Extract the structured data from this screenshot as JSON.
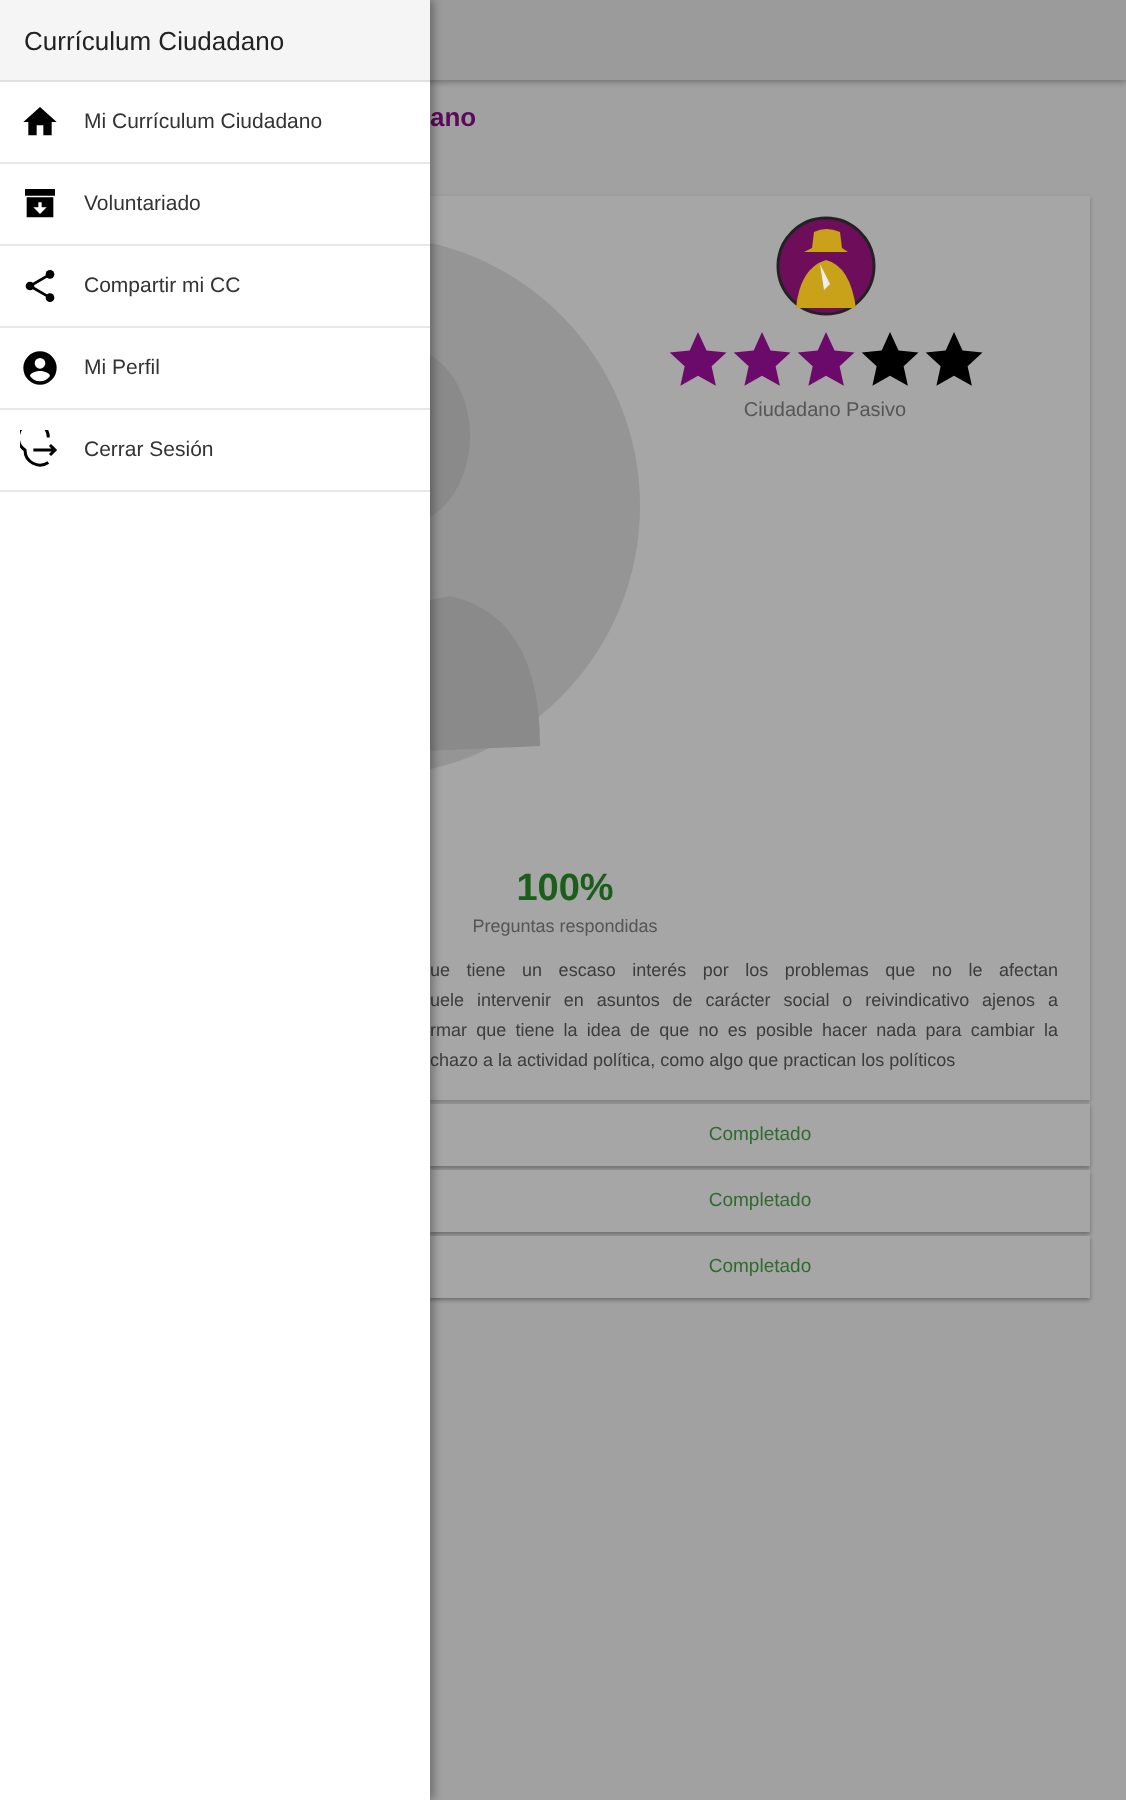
{
  "drawer": {
    "title": "Currículum Ciudadano",
    "items": [
      {
        "label": "Mi Currículum Ciudadano",
        "kind": "home"
      },
      {
        "label": "Voluntariado",
        "kind": "archive"
      },
      {
        "label": "Compartir mi CC",
        "kind": "share"
      },
      {
        "label": "Mi Perfil",
        "kind": "account"
      },
      {
        "label": "Cerrar Sesión",
        "kind": "logout"
      }
    ]
  },
  "page": {
    "title": "ano",
    "profile": {
      "stars": 3,
      "level_name": "Ciudadano Pasivo"
    },
    "progress": {
      "value": "100%",
      "label": "Preguntas respondidas"
    },
    "description_lines": [
      "ue tiene un escaso interés por los problemas que no le afectan",
      "uele intervenir en asuntos de carácter social o reivindicativo ajenos a",
      "rmar que tiene la idea de que no es posible hacer nada para cambiar la",
      "chazo a la actividad política, como algo que practican los políticos"
    ],
    "sections": [
      {
        "status": "Completado"
      },
      {
        "status": "Completado"
      },
      {
        "status": "Completado"
      }
    ]
  }
}
